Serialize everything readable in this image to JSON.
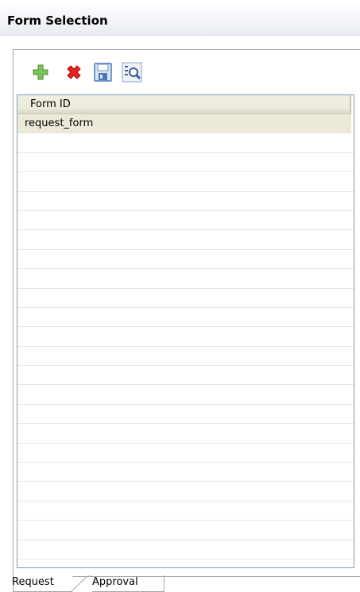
{
  "view": {
    "title": "Form Selection"
  },
  "toolbar": {
    "buttons": [
      {
        "icon": "add-icon",
        "color": "#6cb04a"
      },
      {
        "icon": "delete-icon",
        "color": "#e02020"
      },
      {
        "icon": "save-icon",
        "color": "#4a78b8"
      },
      {
        "icon": "find-icon",
        "color": "#3a5e96"
      }
    ]
  },
  "table": {
    "columns": [
      "Form ID"
    ],
    "rows": [
      {
        "form_id": "request_form",
        "selected": true
      }
    ]
  },
  "tabs": [
    {
      "label": "Request",
      "active": true
    },
    {
      "label": "Approval",
      "active": false
    }
  ],
  "colors": {
    "header_bg": "#ece9d8",
    "border": "#7f9db9"
  }
}
